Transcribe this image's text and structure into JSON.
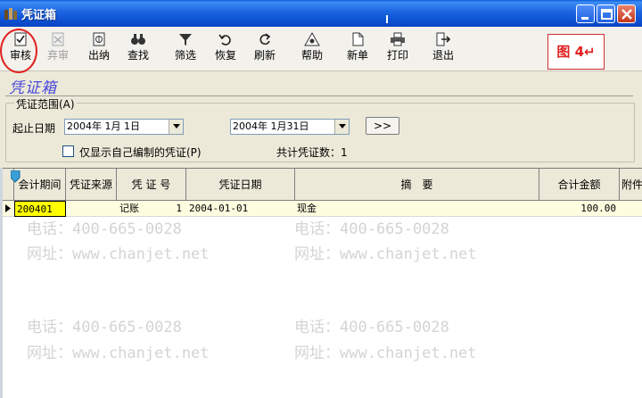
{
  "window": {
    "title": "凭证箱"
  },
  "toolbar": {
    "items": [
      {
        "label": "审核",
        "icon": "check-doc-icon",
        "enabled": true
      },
      {
        "label": "弃审",
        "icon": "unaudit-icon",
        "enabled": false
      },
      {
        "label": "出纳",
        "icon": "cashier-icon",
        "enabled": true
      },
      {
        "label": "查找",
        "icon": "binoculars-icon",
        "enabled": true
      },
      {
        "label": "筛选",
        "icon": "filter-icon",
        "enabled": true
      },
      {
        "label": "恢复",
        "icon": "undo-icon",
        "enabled": true
      },
      {
        "label": "刷新",
        "icon": "refresh-icon",
        "enabled": true
      },
      {
        "label": "帮助",
        "icon": "help-icon",
        "enabled": true
      },
      {
        "label": "新单",
        "icon": "new-doc-icon",
        "enabled": true
      },
      {
        "label": "打印",
        "icon": "printer-icon",
        "enabled": true
      },
      {
        "label": "退出",
        "icon": "exit-icon",
        "enabled": true
      }
    ],
    "annotation_label": "图 4↵"
  },
  "header": {
    "script_title": "凭证箱"
  },
  "range": {
    "legend": "凭证范围(A)",
    "start_end_label": "起止日期",
    "start_date": "2004年 1月 1日",
    "end_date": "2004年 1月31日",
    "go_button": ">>",
    "only_mine_label": "仅显示自己编制的凭证(P)",
    "only_mine_checked": false,
    "total_label": "共计凭证数：1"
  },
  "grid": {
    "columns": [
      "会计期间",
      "凭证来源",
      "凭 证 号",
      "凭证日期",
      "摘　要",
      "合计金额",
      "附件"
    ],
    "rows": [
      {
        "period": "200401",
        "source": "",
        "voucher_type": "记账",
        "voucher_no": "1",
        "date": "2004-01-01",
        "summary": "现金",
        "amount": "100.00",
        "attachments": ""
      }
    ]
  },
  "watermark": {
    "phone": "电话：400-665-0028",
    "site": "网址：www.chanjet.net"
  },
  "colors": {
    "titlebar": "#1b64e0",
    "selected_cell": "#ffff00",
    "row_highlight": "#fefde0",
    "annotation_red": "#e02020"
  }
}
